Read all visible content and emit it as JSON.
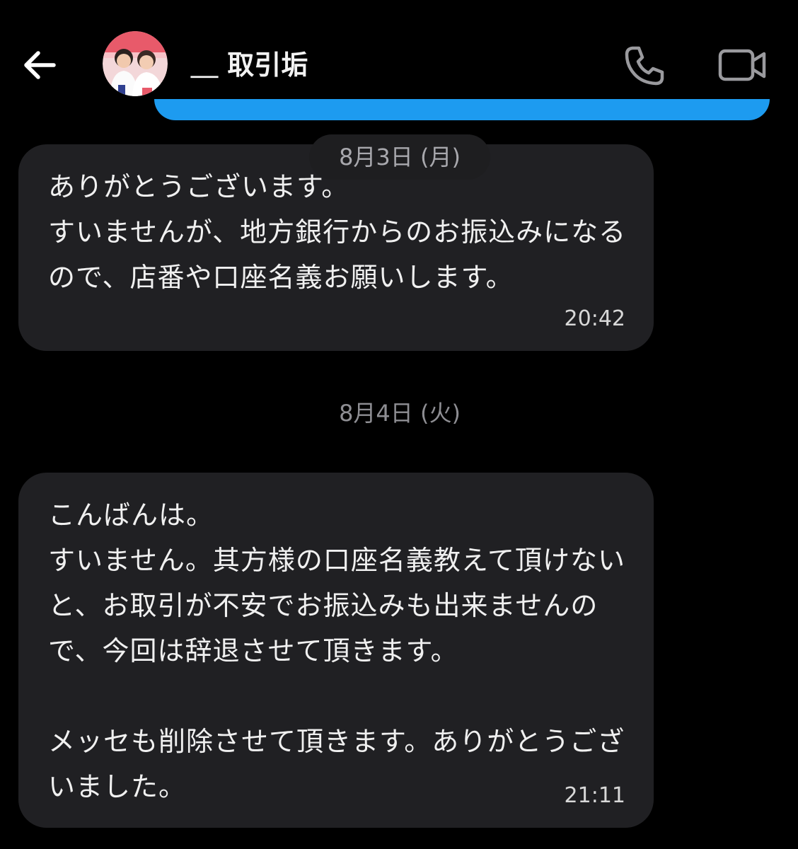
{
  "header": {
    "back_icon": "arrow-left-icon",
    "contact_name": "＿ 取引垢",
    "call_icon": "phone-icon",
    "video_icon": "video-camera-icon"
  },
  "colors": {
    "background": "#000000",
    "bubble": "#202023",
    "accent": "#1d9bf0",
    "date_pill": "#1e1e20"
  },
  "conversation": {
    "date_1": "8月3日 (月)",
    "messages_day1": [
      {
        "text": "ありがとうございます。\nすいませんが、地方銀行からのお振込みになるので、店番や口座名義お願いします。",
        "time": "20:42"
      }
    ],
    "date_2": "8月4日 (火)",
    "messages_day2": [
      {
        "text": "こんばんは。\nすいません。其方様の口座名義教えて頂けないと、お取引が不安でお振込みも出来ませんので、今回は辞退させて頂きます。\n\nメッセも削除させて頂きます。ありがとうございました。",
        "time": "21:11"
      }
    ]
  }
}
